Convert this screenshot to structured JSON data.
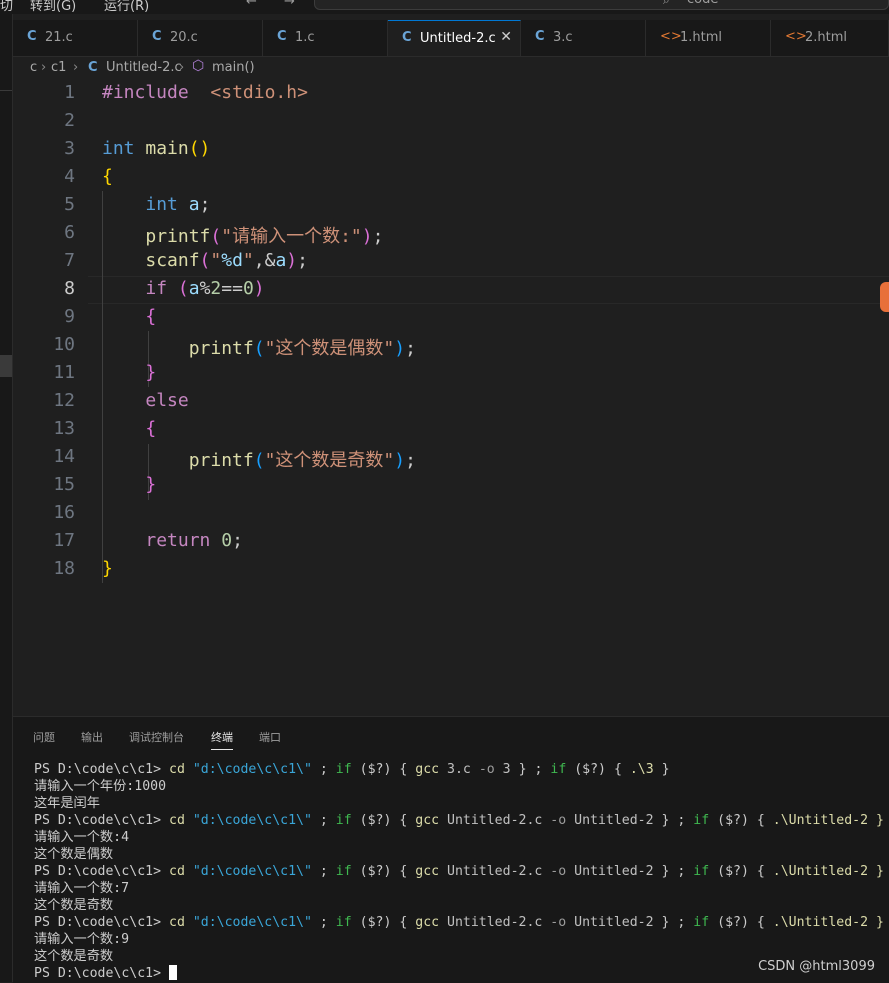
{
  "menubar": {
    "item_left": "切",
    "item_select": "转到(G)",
    "item_run": "运行(R)",
    "back": "←",
    "forward": "→",
    "search_text": "code",
    "search_icon": "search-icon"
  },
  "tabs": [
    {
      "icon": "C",
      "label": "21.c"
    },
    {
      "icon": "C",
      "label": "20.c"
    },
    {
      "icon": "C",
      "label": "1.c"
    },
    {
      "icon": "C",
      "label": "Untitled-2.c",
      "active": true,
      "close": "✕"
    },
    {
      "icon": "C",
      "label": "3.c"
    },
    {
      "icon": "<>",
      "label": "1.html"
    },
    {
      "icon": "<>",
      "label": "2.html"
    }
  ],
  "breadcrumb": {
    "root": "c",
    "folder": "c1",
    "file": "Untitled-2.c",
    "symbol": "main()",
    "sep": "›"
  },
  "editor": {
    "current_line": 8,
    "lines": [
      "1",
      "2",
      "3",
      "4",
      "5",
      "6",
      "7",
      "8",
      "9",
      "10",
      "11",
      "12",
      "13",
      "14",
      "15",
      "16",
      "17",
      "18"
    ],
    "code": {
      "l1_kw": "#include",
      "l1_path": "<stdio.h>",
      "l3_type": "int",
      "l3_fn": "main",
      "l3_paren": "()",
      "l4_brace": "{",
      "l5_type": "int",
      "l5_var": "a",
      "l5_end": ";",
      "l6_fn": "printf",
      "l6_open": "(",
      "l6_str": "\"请输入一个数:\"",
      "l6_close": ")",
      "l6_end": ";",
      "l7_fn": "scanf",
      "l7_open": "(",
      "l7_q1": "\"",
      "l7_fmt": "%d",
      "l7_q2": "\"",
      "l7_amp": ",&",
      "l7_var": "a",
      "l7_close": ")",
      "l7_end": ";",
      "l8_kw": "if",
      "l8_open": "(",
      "l8_var": "a",
      "l8_op1": "%",
      "l8_two": "2",
      "l8_op2": "==",
      "l8_zero": "0",
      "l8_close": ")",
      "l9_brace": "{",
      "l10_fn": "printf",
      "l10_open": "(",
      "l10_str": "\"这个数是偶数\"",
      "l10_close": ")",
      "l10_end": ";",
      "l11_brace": "}",
      "l12_kw": "else",
      "l13_brace": "{",
      "l14_fn": "printf",
      "l14_open": "(",
      "l14_str": "\"这个数是奇数\"",
      "l14_close": ")",
      "l14_end": ";",
      "l15_brace": "}",
      "l17_kw": "return",
      "l17_zero": "0",
      "l17_end": ";",
      "l18_brace": "}"
    }
  },
  "panel": {
    "tabs": [
      "问题",
      "输出",
      "调试控制台",
      "终端",
      "端口"
    ],
    "active_tab": "终端",
    "terminal": {
      "prompt": "PS D:\\code\\c\\c1>",
      "cmd_cd": "cd",
      "path": "\"d:\\code\\c\\c1\\\"",
      "semi": ";",
      "if_kw": "if",
      "cond": "($?)",
      "lbrace": "{",
      "rbrace": "}",
      "gcc": "gcc",
      "opt_o": "-o",
      "run1": [
        "3.c",
        "3",
        ".\\3"
      ],
      "run_u": [
        "Untitled-2.c",
        "Untitled-2",
        ".\\Untitled-2 }"
      ],
      "out1": [
        "请输入一个年份:1000",
        "这年是闰年"
      ],
      "out2": [
        "请输入一个数:4",
        "这个数是偶数"
      ],
      "out3": [
        "请输入一个数:7",
        "这个数是奇数"
      ],
      "out4": [
        "请输入一个数:9",
        "这个数是奇数"
      ]
    }
  },
  "watermark": "CSDN @html3099"
}
